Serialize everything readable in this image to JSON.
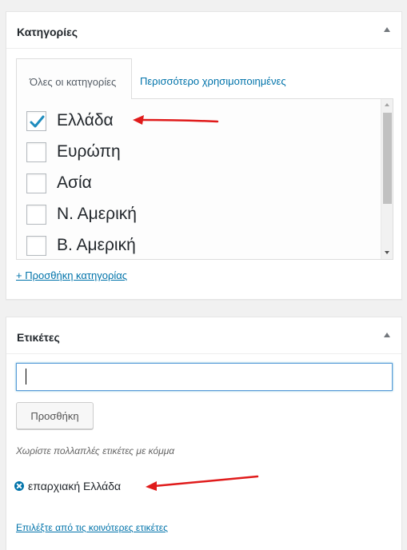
{
  "categories_box": {
    "title": "Κατηγορίες",
    "tabs": [
      {
        "label": "Όλες οι κατηγορίες",
        "active": true
      },
      {
        "label": "Περισσότερο χρησιμοποιημένες",
        "active": false
      }
    ],
    "items": [
      {
        "label": "Ελλάδα",
        "checked": true
      },
      {
        "label": "Ευρώπη",
        "checked": false
      },
      {
        "label": "Ασία",
        "checked": false
      },
      {
        "label": "Ν. Αμερική",
        "checked": false
      },
      {
        "label": "Β. Αμερική",
        "checked": false
      }
    ],
    "add_link": "+ Προσθήκη κατηγορίας"
  },
  "tags_box": {
    "title": "Ετικέτες",
    "input_value": "",
    "add_button": "Προσθήκη",
    "hint": "Χωρίστε πολλαπλές ετικέτες με κόμμα",
    "tags": [
      {
        "label": "επαρχιακή Ελλάδα"
      }
    ],
    "popular_link": "Επιλέξτε από τις κοινότερες ετικέτες"
  },
  "colors": {
    "link": "#0073aa",
    "checkmark": "#1e8cbe",
    "annotation_arrow": "#e01b1b",
    "focus_border": "#5b9dd9"
  },
  "icons": {
    "toggle": "triangle-up-icon",
    "checkmark": "checkmark-icon",
    "remove_tag": "remove-tag-icon"
  }
}
